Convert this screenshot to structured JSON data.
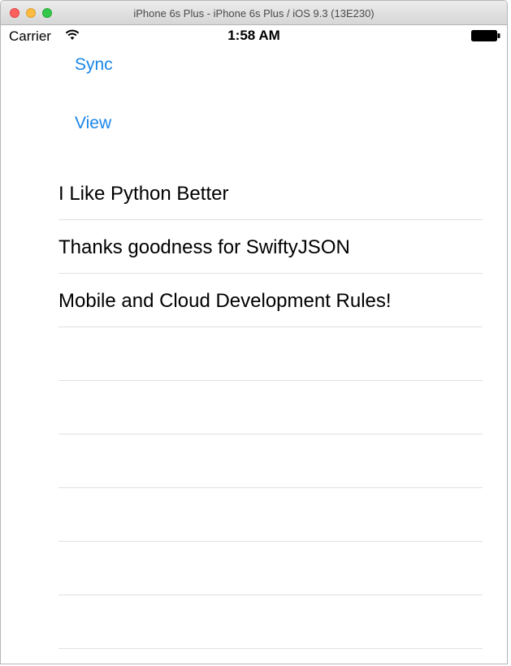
{
  "window": {
    "title": "iPhone 6s Plus - iPhone 6s Plus / iOS 9.3 (13E230)"
  },
  "status_bar": {
    "carrier": "Carrier",
    "time": "1:58 AM"
  },
  "buttons": {
    "sync_label": "Sync",
    "view_label": "View"
  },
  "list": {
    "items": [
      {
        "label": "I Like Python Better"
      },
      {
        "label": "Thanks goodness for SwiftyJSON"
      },
      {
        "label": "Mobile and Cloud Development Rules!"
      },
      {
        "label": ""
      },
      {
        "label": ""
      },
      {
        "label": ""
      },
      {
        "label": ""
      },
      {
        "label": ""
      },
      {
        "label": ""
      }
    ]
  },
  "colors": {
    "accent": "#1a86e8",
    "separator": "#e0e0e0"
  }
}
